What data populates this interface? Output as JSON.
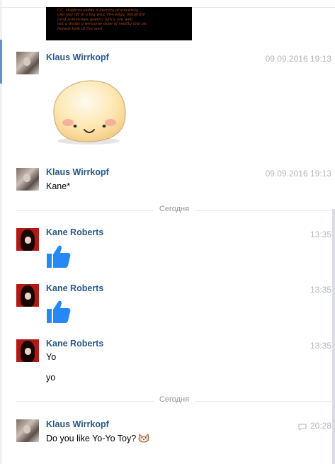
{
  "preview_image": {
    "lines": [
      "CC, Hopkins sheds a literary of sincerely",
      "and pay off in a big way. The edgy, insightful",
      "(and sometimes poetic) lyrics are well",
      "out a doubt a welcome dose of reality and an",
      "honest look at the soul."
    ]
  },
  "messages": [
    {
      "author": "Klaus Wirrkopf",
      "time": "09.09.2016 19:13",
      "kind": "sticker"
    },
    {
      "author": "Klaus Wirrkopf",
      "time": "09.09.2016 19:13",
      "text": "Kane*"
    },
    {
      "author": "Kane Roberts",
      "time": "13:35",
      "kind": "like"
    },
    {
      "author": "Kane Roberts",
      "time": "13:35",
      "kind": "like"
    },
    {
      "author": "Kane Roberts",
      "time": "13:35",
      "text": "Yo",
      "text2": "yo"
    },
    {
      "author": "Klaus Wirrkopf",
      "time": "20:28",
      "text": "Do you like Yo-Yo Toy?"
    }
  ],
  "dividers": [
    "Сегодня",
    "Сегодня"
  ],
  "colors": {
    "author": "#2a5885",
    "time": "#b0b5bb",
    "divider_line": "#e7e8ec",
    "like_blue": "#2787f5",
    "accent_bar": "#6a8cbe"
  },
  "icons": {
    "sticker": "smiling-bun-sticker",
    "like": "thumbs-up-icon",
    "reply": "reply-icon",
    "emoji": "dog-emoji-icon"
  }
}
